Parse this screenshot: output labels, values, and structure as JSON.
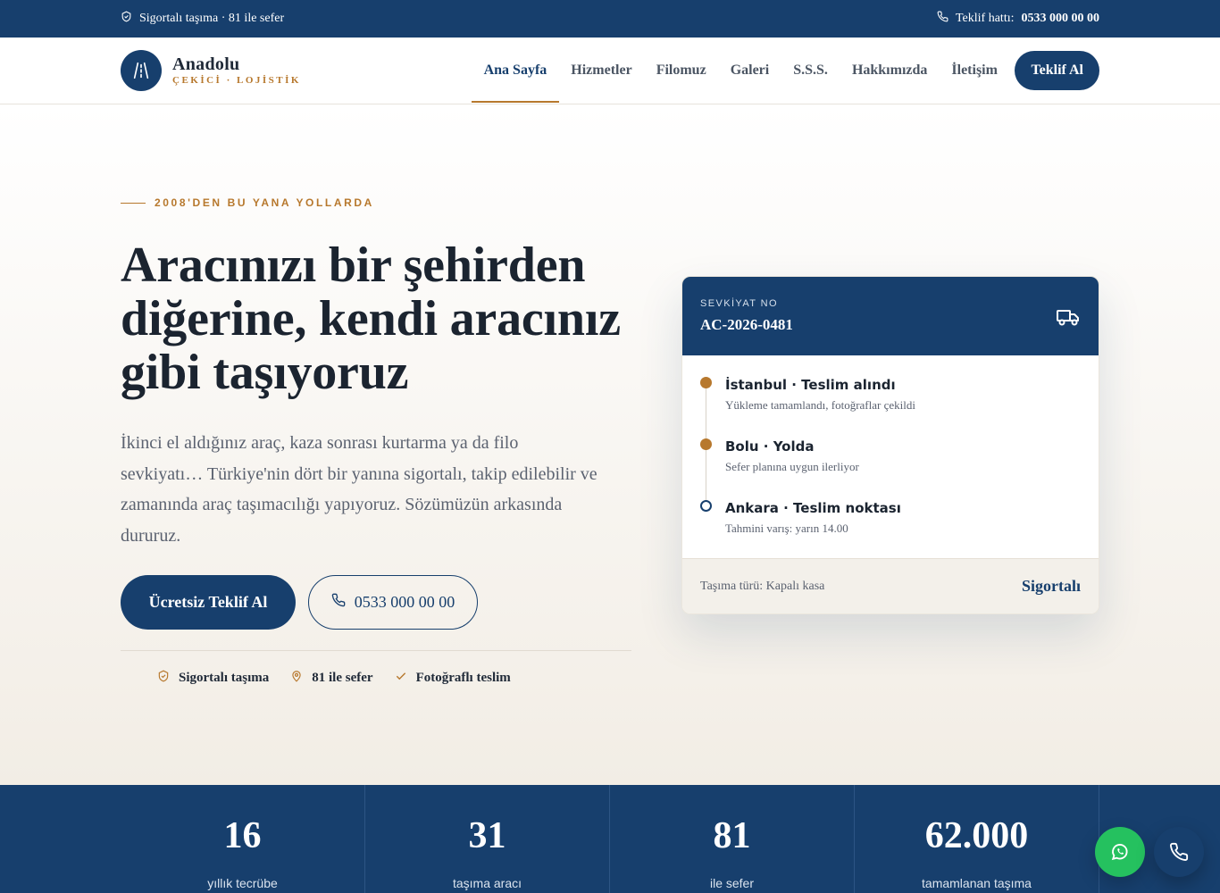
{
  "topbar": {
    "left_text": "Sigortalı taşıma · 81 ile sefer",
    "hotline_label": "Teklif hattı:",
    "hotline_number": "0533 000 00 00"
  },
  "brand": {
    "name": "Anadolu",
    "tagline": "ÇEKİCİ · LOJİSTİK"
  },
  "nav": {
    "items": [
      {
        "label": "Ana Sayfa",
        "active": true
      },
      {
        "label": "Hizmetler",
        "active": false
      },
      {
        "label": "Filomuz",
        "active": false
      },
      {
        "label": "Galeri",
        "active": false
      },
      {
        "label": "S.S.S.",
        "active": false
      },
      {
        "label": "Hakkımızda",
        "active": false
      },
      {
        "label": "İletişim",
        "active": false
      }
    ],
    "cta_label": "Teklif Al"
  },
  "hero": {
    "eyebrow": "2008'DEN BU YANA YOLLARDA",
    "title": "Aracınızı bir şehirden diğerine, kendi aracınız gibi taşıyoruz",
    "description": "İkinci el aldığınız araç, kaza sonrası kurtarma ya da filo sevkiyatı… Türkiye'nin dört bir yanına sigortalı, takip edilebilir ve zamanında araç taşımacılığı yapıyoruz. Sözümüzün arkasında dururuz.",
    "primary_button": "Ücretsiz Teklif Al",
    "phone_button": "0533 000 00 00",
    "features": [
      "Sigortalı taşıma",
      "81 ile sefer",
      "Fotoğraflı teslim"
    ]
  },
  "shipment": {
    "label": "SEVKİYAT NO",
    "number": "AC-2026-0481",
    "steps": [
      {
        "title": "İstanbul · Teslim alındı",
        "sub": "Yükleme tamamlandı, fotoğraflar çekildi"
      },
      {
        "title": "Bolu · Yolda",
        "sub": "Sefer planına uygun ilerliyor"
      },
      {
        "title": "Ankara · Teslim noktası",
        "sub": "Tahmini varış: yarın 14.00"
      }
    ],
    "type": "Taşıma türü: Kapalı kasa",
    "badge": "Sigortalı"
  },
  "stats": [
    {
      "value": "16",
      "label": "yıllık tecrübe"
    },
    {
      "value": "31",
      "label": "taşıma aracı"
    },
    {
      "value": "81",
      "label": "ile sefer"
    },
    {
      "value": "62.000",
      "label": "tamamlanan taşıma"
    }
  ],
  "colors": {
    "navy": "#173f6d",
    "accent": "#b7782d",
    "whatsapp": "#25c15f"
  }
}
